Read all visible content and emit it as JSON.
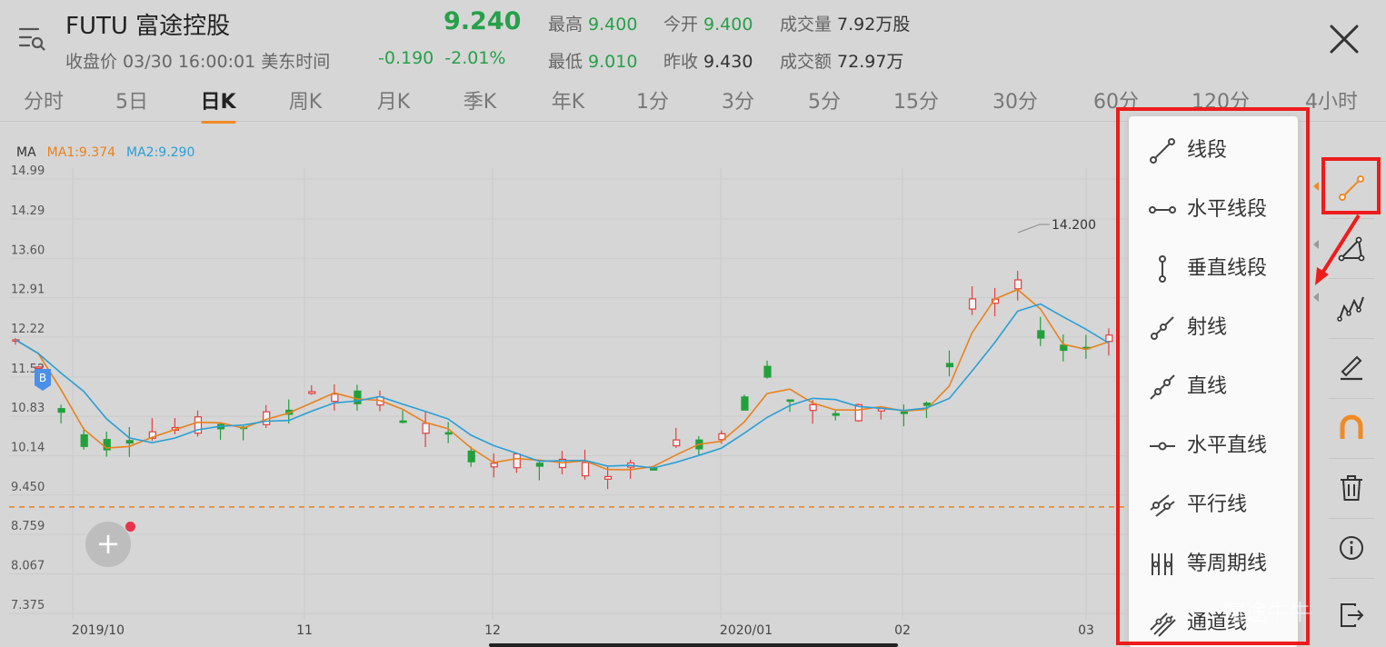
{
  "header": {
    "title": "FUTU 富途控股",
    "subtitle": "收盘价 03/30 16:00:01 美东时间",
    "price": "9.240",
    "change": "-0.190",
    "change_pct": "-2.01%",
    "stats": {
      "high_label": "最高",
      "high": "9.400",
      "open_label": "今开",
      "open": "9.400",
      "volume_label": "成交量",
      "volume": "7.92万股",
      "low_label": "最低",
      "low": "9.010",
      "prev_close_label": "昨收",
      "prev_close": "9.430",
      "turnover_label": "成交额",
      "turnover": "72.97万"
    }
  },
  "tabs": [
    "分时",
    "5日",
    "日K",
    "周K",
    "月K",
    "季K",
    "年K",
    "1分",
    "3分",
    "5分",
    "15分",
    "30分",
    "60分",
    "120分",
    "4小时"
  ],
  "active_tab": "日K",
  "chart": {
    "ma_label": "MA",
    "ma1": "MA1:9.374",
    "ma2": "MA2:9.290",
    "ma1_color": "#e8821e",
    "ma2_color": "#2a9fd6",
    "up_color": "#e04040",
    "down_color": "#22a03c",
    "y_ticks": [
      "14.99",
      "14.29",
      "13.60",
      "12.91",
      "12.22",
      "11.52",
      "10.83",
      "10.14",
      "9.450",
      "8.759",
      "8.067",
      "7.375"
    ],
    "x_ticks": [
      "2019/10",
      "11",
      "12",
      "2020/01",
      "02",
      "03"
    ],
    "max_label": "14.200",
    "buy_marker": "B",
    "last_price_line": 9.24
  },
  "fab_label": "+",
  "draw_menu": {
    "items": [
      {
        "label": "线段",
        "icon": "line-segment-icon"
      },
      {
        "label": "水平线段",
        "icon": "horizontal-segment-icon"
      },
      {
        "label": "垂直线段",
        "icon": "vertical-segment-icon"
      },
      {
        "label": "射线",
        "icon": "ray-icon"
      },
      {
        "label": "直线",
        "icon": "straight-line-icon"
      },
      {
        "label": "水平直线",
        "icon": "horizontal-line-icon"
      },
      {
        "label": "平行线",
        "icon": "parallel-line-icon"
      },
      {
        "label": "等周期线",
        "icon": "equal-period-icon"
      },
      {
        "label": "通道线",
        "icon": "channel-line-icon"
      }
    ]
  },
  "toolbar": {
    "items": [
      {
        "icon": "draw-line-icon",
        "active": true
      },
      {
        "icon": "triangle-shape-icon"
      },
      {
        "icon": "wave-pattern-icon"
      },
      {
        "icon": "pen-draw-icon"
      },
      {
        "icon": "magnet-icon"
      },
      {
        "icon": "trash-icon"
      },
      {
        "icon": "info-icon"
      },
      {
        "icon": "exit-icon"
      }
    ]
  },
  "watermark": "富途牛牛"
}
